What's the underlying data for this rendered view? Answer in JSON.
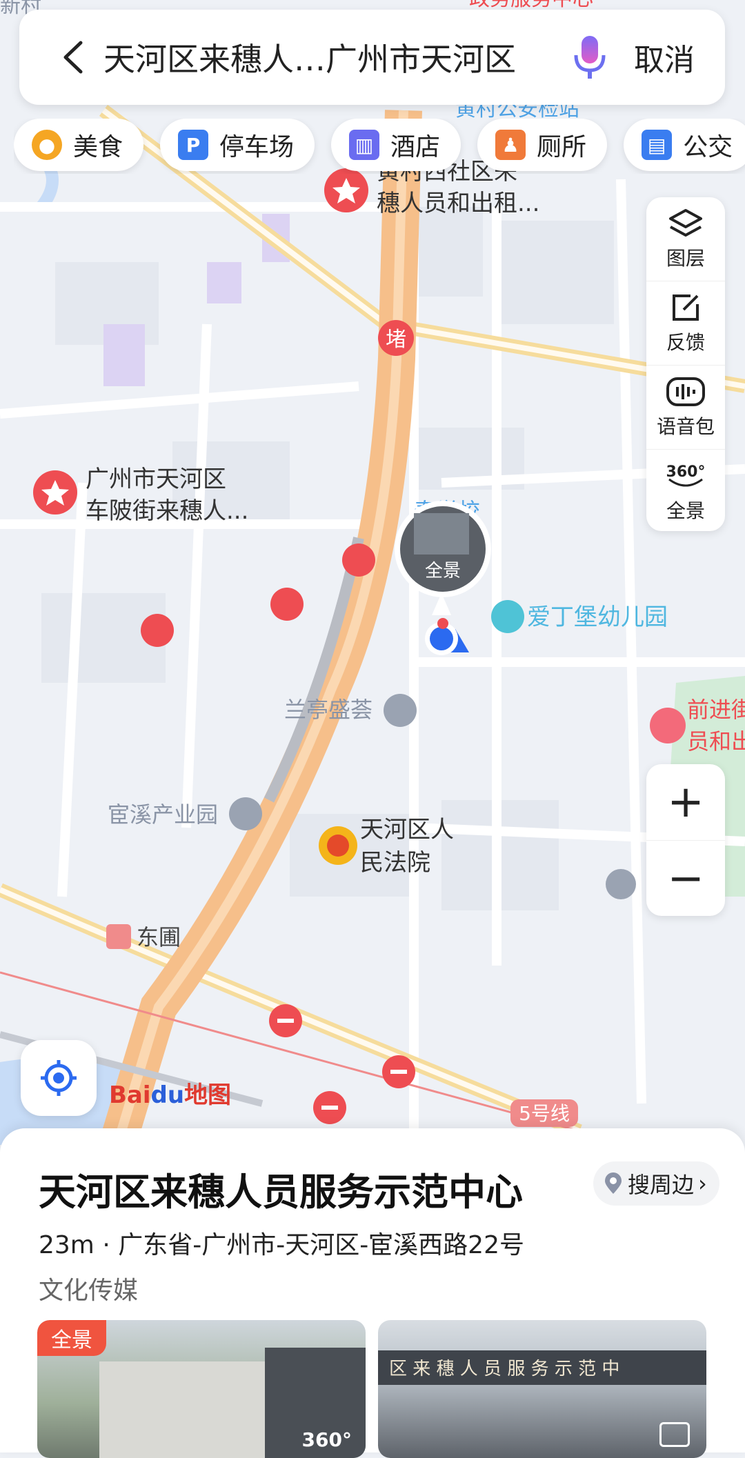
{
  "search": {
    "query": "天河区来穗人…广州市天河区",
    "cancel_label": "取消"
  },
  "categories": [
    {
      "label": "美食",
      "icon": "food-icon",
      "color": "#f5a623"
    },
    {
      "label": "停车场",
      "icon": "parking-icon",
      "color": "#3a7df0"
    },
    {
      "label": "酒店",
      "icon": "hotel-icon",
      "color": "#6a6cf0"
    },
    {
      "label": "厕所",
      "icon": "toilet-icon",
      "color": "#f07a3a"
    },
    {
      "label": "公交",
      "icon": "bus-icon",
      "color": "#3a7df0"
    }
  ],
  "tools": [
    {
      "label": "图层",
      "icon": "layers-icon"
    },
    {
      "label": "反馈",
      "icon": "feedback-icon"
    },
    {
      "label": "语音包",
      "icon": "voice-pack-icon"
    },
    {
      "label": "全景",
      "icon": "panorama-360-icon"
    }
  ],
  "map": {
    "pois": {
      "p1": "黄村西社区来",
      "p1b": "穗人员和出租...",
      "p2": "广州市天河区",
      "p2b": "车陂街来穗人...",
      "p3": "前进街",
      "p3b": "员和出",
      "school": "泰学校",
      "kindergarten": "爱丁堡幼儿园",
      "lanting": "兰亭盛荟",
      "yuanxi": "宦溪产业园",
      "court": "天河区人",
      "courtb": "民法院",
      "metro": "东圃",
      "top_label": "政务服务中心",
      "top_label2": "黄村公安检站",
      "edge": "新村",
      "edge2": "务中"
    },
    "pano_label": "全景",
    "jam": "堵",
    "line5": "5号线",
    "logo_bai": "Bai",
    "logo_du": "du",
    "logo_map": "地图"
  },
  "place": {
    "name": "天河区来穗人员服务示范中心",
    "nearby_label": "搜周边",
    "distance_address": "23m · 广东省-广州市-天河区-宦溪西路22号",
    "category": "文化传媒",
    "photo_badge": "全景",
    "photo2_sign": "区 来 穗 人 员 服 务 示 范 中",
    "pano_icon_text": "360°"
  },
  "colors": {
    "accent": "#2b6af0",
    "poi_red": "#ee4d52",
    "road_orange": "#f6bf8a"
  }
}
